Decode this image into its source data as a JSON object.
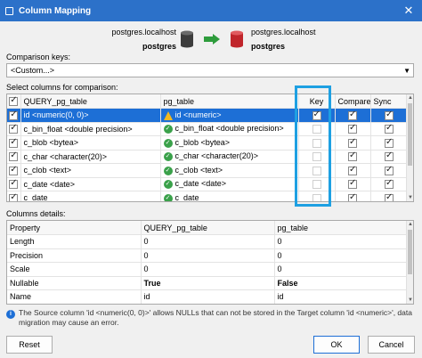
{
  "window": {
    "title": "Column Mapping",
    "close_label": "✕"
  },
  "source": {
    "host": "postgres.localhost",
    "database": "postgres",
    "db_color": "#3c3c3c"
  },
  "target": {
    "host": "postgres.localhost",
    "database": "postgres",
    "db_color": "#c0252b"
  },
  "arrow_color": "#2e9c3c",
  "comparison_keys": {
    "label": "Comparison keys:",
    "selected": "<Custom...>"
  },
  "columns_section": {
    "label": "Select columns for comparison:",
    "headers": {
      "query": "QUERY_pg_table",
      "target": "pg_table",
      "key": "Key",
      "compare": "Compare",
      "sync": "Sync"
    },
    "rows": [
      {
        "checked": true,
        "source": "id <numeric(0, 0)>",
        "status": "warning",
        "target": "id <numeric>",
        "key": true,
        "compare": true,
        "sync": true,
        "selected": true
      },
      {
        "checked": true,
        "source": "c_bin_float <double precision>",
        "status": "ok",
        "target": "c_bin_float <double precision>",
        "key": false,
        "compare": true,
        "sync": true,
        "selected": false
      },
      {
        "checked": true,
        "source": "c_blob <bytea>",
        "status": "ok",
        "target": "c_blob <bytea>",
        "key": false,
        "compare": true,
        "sync": true,
        "selected": false
      },
      {
        "checked": true,
        "source": "c_char <character(20)>",
        "status": "ok",
        "target": "c_char <character(20)>",
        "key": false,
        "compare": true,
        "sync": true,
        "selected": false
      },
      {
        "checked": true,
        "source": "c_clob <text>",
        "status": "ok",
        "target": "c_clob <text>",
        "key": false,
        "compare": true,
        "sync": true,
        "selected": false
      },
      {
        "checked": true,
        "source": "c_date <date>",
        "status": "ok",
        "target": "c_date <date>",
        "key": false,
        "compare": true,
        "sync": true,
        "selected": false
      },
      {
        "checked": true,
        "source": "c_date_",
        "status": "ok",
        "target": "c_date_",
        "key": false,
        "compare": true,
        "sync": true,
        "selected": false
      }
    ]
  },
  "details_section": {
    "label": "Columns details:",
    "headers": {
      "property": "Property",
      "query": "QUERY_pg_table",
      "target": "pg_table"
    },
    "rows": [
      {
        "property": "Length",
        "query": "0",
        "target": "0",
        "bold": false
      },
      {
        "property": "Precision",
        "query": "0",
        "target": "0",
        "bold": false
      },
      {
        "property": "Scale",
        "query": "0",
        "target": "0",
        "bold": false
      },
      {
        "property": "Nullable",
        "query": "True",
        "target": "False",
        "bold": true
      },
      {
        "property": "Name",
        "query": "id",
        "target": "id",
        "bold": false
      }
    ]
  },
  "info_message": "The Source column 'id <numeric(0, 0)>' allows NULLs that can not be stored in the Target column 'id <numeric>', data migration may cause an error.",
  "buttons": {
    "reset": "Reset",
    "ok": "OK",
    "cancel": "Cancel"
  }
}
